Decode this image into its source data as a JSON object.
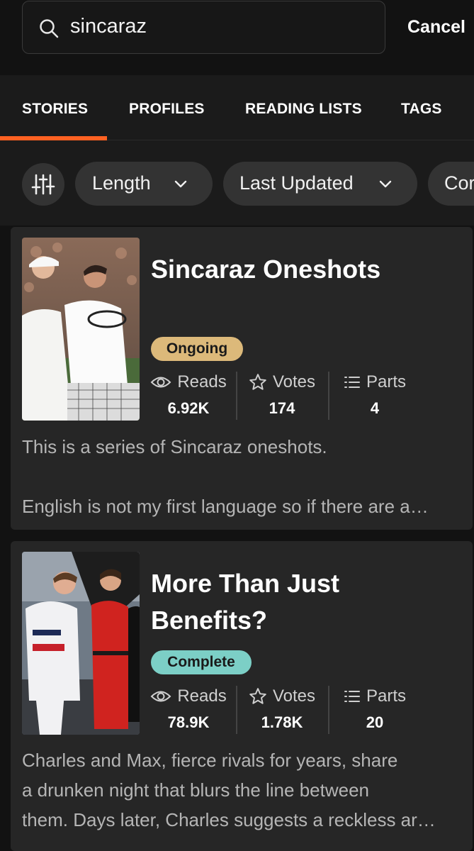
{
  "search": {
    "query": "sincaraz",
    "cancel_label": "Cancel"
  },
  "tabs": [
    {
      "label": "STORIES",
      "active": true
    },
    {
      "label": "PROFILES",
      "active": false
    },
    {
      "label": "READING LISTS",
      "active": false
    },
    {
      "label": "TAGS",
      "active": false
    }
  ],
  "filters": {
    "length_label": "Length",
    "updated_label": "Last Updated",
    "content_label_partial": "Cor"
  },
  "colors": {
    "accent": "#ff6122",
    "ongoing": "#dcb97a",
    "complete": "#7ccfc6"
  },
  "stories": [
    {
      "title": "Sincaraz Oneshots",
      "status": "Ongoing",
      "reads_label": "Reads",
      "reads": "6.92K",
      "votes_label": "Votes",
      "votes": "174",
      "parts_label": "Parts",
      "parts": "4",
      "description_lines": [
        "This is a series of Sincaraz oneshots.",
        "",
        "English is not my first language so if there are a…"
      ]
    },
    {
      "title_line1": "More Than Just",
      "title_line2": "Benefits?",
      "status": "Complete",
      "reads_label": "Reads",
      "reads": "78.9K",
      "votes_label": "Votes",
      "votes": "1.78K",
      "parts_label": "Parts",
      "parts": "20",
      "description_lines": [
        "Charles and Max, fierce rivals for years, share",
        "a drunken night that blurs the line between",
        "them. Days later, Charles suggests a reckless ar…"
      ]
    }
  ]
}
